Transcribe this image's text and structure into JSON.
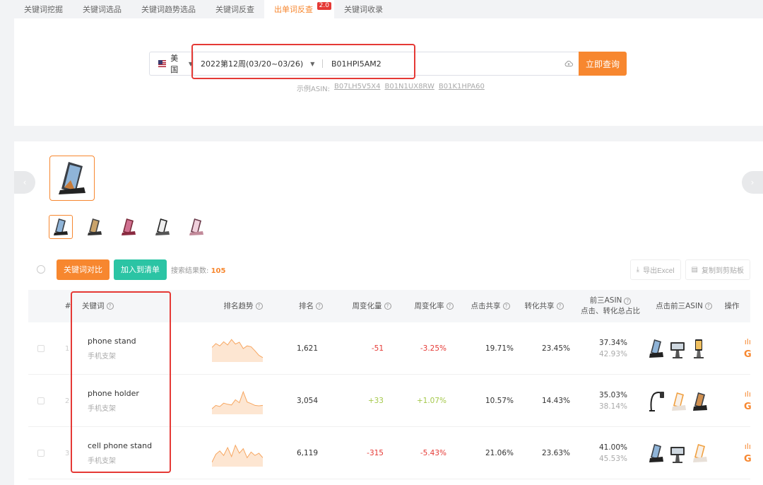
{
  "tabs": [
    {
      "label": "关键词挖掘"
    },
    {
      "label": "关键词选品"
    },
    {
      "label": "关键词趋势选品"
    },
    {
      "label": "关键词反查"
    },
    {
      "label": "出单词反查",
      "badge": "2.0",
      "active": true
    },
    {
      "label": "关键词收录"
    }
  ],
  "search": {
    "country": "美国",
    "week": "2022第12周(03/20~03/26)",
    "asin": "B01HPI5AM2",
    "button": "立即查询",
    "examples_label": "示例ASIN:",
    "examples": [
      "B07LH5V5X4",
      "B01N1UX8RW",
      "B01K1HPA60"
    ]
  },
  "toolbar": {
    "compare_button": "关键词对比",
    "add_list_button": "加入到清单",
    "result_label": "搜索结果数:",
    "result_count": "105",
    "export_button": "导出Excel",
    "copy_button": "复制到剪贴板"
  },
  "table": {
    "headers": {
      "index": "#",
      "keyword": "关键词",
      "trend": "排名趋势",
      "rank": "排名",
      "weekly_change": "周变化量",
      "weekly_rate": "周变化率",
      "click_share": "点击共享",
      "conv_share": "转化共享",
      "top3_line1": "前三ASIN",
      "top3_line2": "点击、转化总占比",
      "top3_click": "点击前三ASIN",
      "ops": "操作"
    },
    "rows": [
      {
        "index": "1",
        "keyword": "phone stand",
        "translation": "手机支架",
        "rank": "1,621",
        "weekly_change": "-51",
        "weekly_rate": "-3.25%",
        "click_share": "19.71%",
        "conv_share": "23.45%",
        "top3_click": "37.34%",
        "top3_conv": "42.93%",
        "trend": [
          0.55,
          0.72,
          0.62,
          0.8,
          0.66,
          0.9,
          0.7,
          0.78,
          0.5,
          0.62,
          0.58,
          0.4,
          0.2,
          0.1
        ],
        "dir": "neg"
      },
      {
        "index": "2",
        "keyword": "phone holder",
        "translation": "手机支架",
        "rank": "3,054",
        "weekly_change": "+33",
        "weekly_rate": "+1.07%",
        "click_share": "10.57%",
        "conv_share": "14.43%",
        "top3_click": "35.03%",
        "top3_conv": "38.14%",
        "trend": [
          0.15,
          0.3,
          0.25,
          0.4,
          0.35,
          0.32,
          0.55,
          0.42,
          0.9,
          0.45,
          0.38,
          0.3,
          0.28,
          0.3
        ],
        "dir": "pos"
      },
      {
        "index": "3",
        "keyword": "cell phone stand",
        "translation": "手机支架",
        "rank": "6,119",
        "weekly_change": "-315",
        "weekly_rate": "-5.43%",
        "click_share": "21.06%",
        "conv_share": "23.63%",
        "top3_click": "41.00%",
        "top3_conv": "45.53%",
        "trend": [
          0.1,
          0.45,
          0.6,
          0.4,
          0.75,
          0.35,
          0.85,
          0.5,
          0.7,
          0.3,
          0.55,
          0.4,
          0.5,
          0.3
        ],
        "dir": "neg"
      }
    ]
  },
  "colors": {
    "accent": "#f7872f",
    "green": "#2bc4a4",
    "negative": "#e53935",
    "positive": "#a4c84a",
    "highlight": "#e53935"
  }
}
